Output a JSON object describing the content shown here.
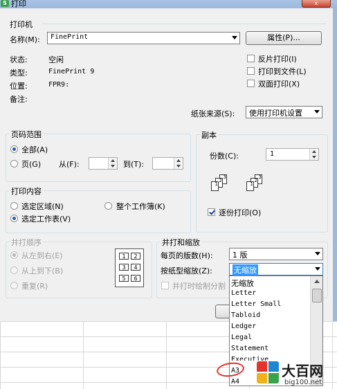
{
  "window": {
    "title": "打印",
    "app_icon": "wps-s-icon"
  },
  "printer": {
    "section_title": "打印机",
    "name_label": "名称(M):",
    "name_value": "FinePrint",
    "properties_button": "属性(P)...",
    "status_label": "状态:",
    "status_value": "空闲",
    "type_label": "类型:",
    "type_value": "FinePrint 9",
    "location_label": "位置:",
    "location_value": "FPR9:",
    "comment_label": "备注:",
    "options": [
      {
        "label": "反片打印(I)",
        "checked": false
      },
      {
        "label": "打印到文件(L)",
        "checked": false
      },
      {
        "label": "双面打印(X)",
        "checked": false
      }
    ],
    "paper_source_label": "纸张来源(S):",
    "paper_source_value": "使用打印机设置"
  },
  "page_range": {
    "title": "页码范围",
    "all_label": "全部(A)",
    "pages_label": "页(G)",
    "from_label": "从(F):",
    "to_label": "到(T):",
    "from_value": "",
    "to_value": "",
    "selected": "all"
  },
  "copies": {
    "title": "副本",
    "count_label": "份数(C):",
    "count_value": "1",
    "collate_label": "逐份打印(O)",
    "collate_checked": true,
    "icon": "collate-pages-icon"
  },
  "print_content": {
    "title": "打印内容",
    "options": [
      {
        "label": "选定区域(N)",
        "selected": false
      },
      {
        "label": "整个工作簿(K)",
        "selected": false
      },
      {
        "label": "选定工作表(V)",
        "selected": true
      }
    ]
  },
  "page_order": {
    "title": "并打顺序",
    "options": [
      {
        "label": "从左到右(E)",
        "selected": true
      },
      {
        "label": "从上到下(B)",
        "selected": false
      },
      {
        "label": "重复(R)",
        "selected": false
      }
    ],
    "preview_pages": [
      "1",
      "2",
      "3",
      "4",
      "5",
      "6"
    ]
  },
  "zoom": {
    "title": "并打和缩放",
    "pages_per_sheet_label": "每页的版数(H):",
    "pages_per_sheet_value": "1 版",
    "scale_label": "按纸型缩放(Z):",
    "scale_value": "无缩放",
    "draw_borders_label": "并打时绘制分割",
    "draw_borders_checked": false,
    "dropdown_options": [
      "无缩放",
      "Letter",
      "Letter Small",
      "Tabloid",
      "Ledger",
      "Legal",
      "Statement",
      "Executive",
      "A3",
      "A4"
    ]
  },
  "buttons": {
    "ok_label": ""
  },
  "watermark": {
    "brand": "大百网",
    "url": "big100.net"
  },
  "colors": {
    "accent": "#2b5fa8",
    "highlight_circle": "#e0302a",
    "dialog_bg": "#f0f0f0"
  }
}
